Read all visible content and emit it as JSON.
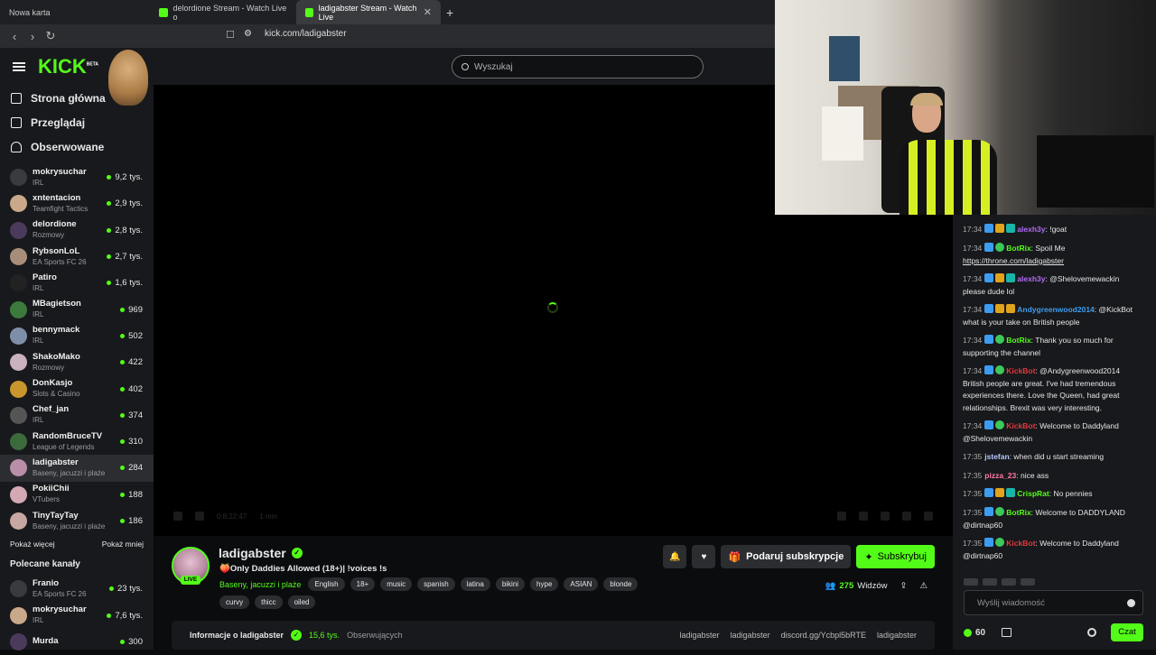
{
  "browser": {
    "tabs": [
      {
        "label": "Nowa karta"
      },
      {
        "label": "delordione Stream - Watch Live o"
      },
      {
        "label": "ladigabster Stream - Watch Live"
      }
    ],
    "url": "kick.com/ladigabster"
  },
  "sidebar": {
    "logo": "KICK",
    "logo_badge": "BETA",
    "nav": [
      {
        "label": "Strona główna"
      },
      {
        "label": "Przeglądaj"
      },
      {
        "label": "Obserwowane"
      }
    ],
    "followed": [
      {
        "name": "mokrysuchar",
        "category": "IRL",
        "viewers": "9,2 tys."
      },
      {
        "name": "xntentacion",
        "category": "Teamfight Tactics",
        "viewers": "2,9 tys."
      },
      {
        "name": "delordione",
        "category": "Rozmowy",
        "viewers": "2,8 tys."
      },
      {
        "name": "RybsonLoL",
        "category": "EA Sports FC 26",
        "viewers": "2,7 tys."
      },
      {
        "name": "Patiro",
        "category": "IRL",
        "viewers": "1,6 tys."
      },
      {
        "name": "MBagietson",
        "category": "IRL",
        "viewers": "969"
      },
      {
        "name": "bennymack",
        "category": "IRL",
        "viewers": "502"
      },
      {
        "name": "ShakoMako",
        "category": "Rozmowy",
        "viewers": "422"
      },
      {
        "name": "DonKasjo",
        "category": "Slots & Casino",
        "viewers": "402"
      },
      {
        "name": "Chef_jan",
        "category": "IRL",
        "viewers": "374"
      },
      {
        "name": "RandomBruceTV",
        "category": "League of Legends",
        "viewers": "310"
      },
      {
        "name": "ladigabster",
        "category": "Baseny, jacuzzi i plaże",
        "viewers": "284"
      },
      {
        "name": "PokiiChii",
        "category": "VTubers",
        "viewers": "188"
      },
      {
        "name": "TinyTayTay",
        "category": "Baseny, jacuzzi i plaże",
        "viewers": "186"
      }
    ],
    "show_more": "Pokaż więcej",
    "show_less": "Pokaż mniej",
    "recommended_title": "Polecane kanały",
    "recommended": [
      {
        "name": "Franio",
        "category": "EA Sports FC 26",
        "viewers": "23 tys."
      },
      {
        "name": "mokrysuchar",
        "category": "IRL",
        "viewers": "7,6 tys."
      },
      {
        "name": "Murda",
        "category": "",
        "viewers": "300"
      }
    ]
  },
  "search": {
    "placeholder": "Wyszukaj"
  },
  "player": {
    "time": "0:8:22:47",
    "status": "1 min"
  },
  "stream": {
    "channel": "ladigabster",
    "live_badge": "LIVE",
    "title": "🍑Only Daddies Allowed (18+)| !voices !s",
    "category": "Baseny, jacuzzi i plaże",
    "tags": [
      "English",
      "18+",
      "music",
      "spanish",
      "latina",
      "bikini",
      "hype",
      "ASIAN",
      "blonde"
    ],
    "tags2": [
      "curvy",
      "thicc",
      "oiled"
    ],
    "gift_label": "Podaruj subskrypcje",
    "subscribe_label": "Subskrybuj",
    "viewers": "275",
    "viewers_label": "Widzów"
  },
  "about": {
    "title": "Informacje o ladigabster",
    "followers": "15,6 tys.",
    "followers_label": "Obserwujących",
    "socials": [
      "ladigabster",
      "ladigabster",
      "discord.gg/Ycbpl5bRTE",
      "ladigabster"
    ]
  },
  "chat": {
    "messages": [
      {
        "time": "17:34",
        "user": "alexh3y",
        "color": "#b16cf5",
        "text": "!goat"
      },
      {
        "time": "17:34",
        "user": "BotRix",
        "color": "#53fc18",
        "text": "Spoil Me",
        "link": "https://throne.com/ladigabster"
      },
      {
        "time": "17:34",
        "user": "alexh3y",
        "color": "#b16cf5",
        "text": "@Shelovemewackin please dude lol"
      },
      {
        "time": "17:34",
        "user": "Andygreenwood2014",
        "color": "#3d9cf0",
        "text": "@KickBot what is your take on British people"
      },
      {
        "time": "17:34",
        "user": "BotRix",
        "color": "#53fc18",
        "text": "Thank you so much for supporting the channel"
      },
      {
        "time": "17:34",
        "user": "KickBot",
        "color": "#e5383b",
        "text": "@Andygreenwood2014 British people are great. I've had tremendous experiences there. Love the Queen, had great relationships. Brexit was very interesting."
      },
      {
        "time": "17:34",
        "user": "KickBot",
        "color": "#e5383b",
        "text": "Welcome to Daddyland @Shelovemewackin"
      },
      {
        "time": "17:35",
        "user": "jstefan",
        "color": "#b9c7ff",
        "text": "when did u start streaming"
      },
      {
        "time": "17:35",
        "user": "pizza_23",
        "color": "#ff7aa8",
        "text": "nice ass"
      },
      {
        "time": "17:35",
        "user": "CrispRat",
        "color": "#53fc18",
        "text": "No pennies"
      },
      {
        "time": "17:35",
        "user": "BotRix",
        "color": "#53fc18",
        "text": "Welcome to DADDYLAND @dirtnap60"
      },
      {
        "time": "17:35",
        "user": "KickBot",
        "color": "#e5383b",
        "text": "Welcome to Daddyland @dirtnap60"
      }
    ],
    "input_placeholder": "Wyślij wiadomość",
    "points": "60",
    "send_label": "Czat"
  },
  "colors": {
    "accent": "#53fc18",
    "bg": "#0b0c0e",
    "panel": "#18191c"
  }
}
